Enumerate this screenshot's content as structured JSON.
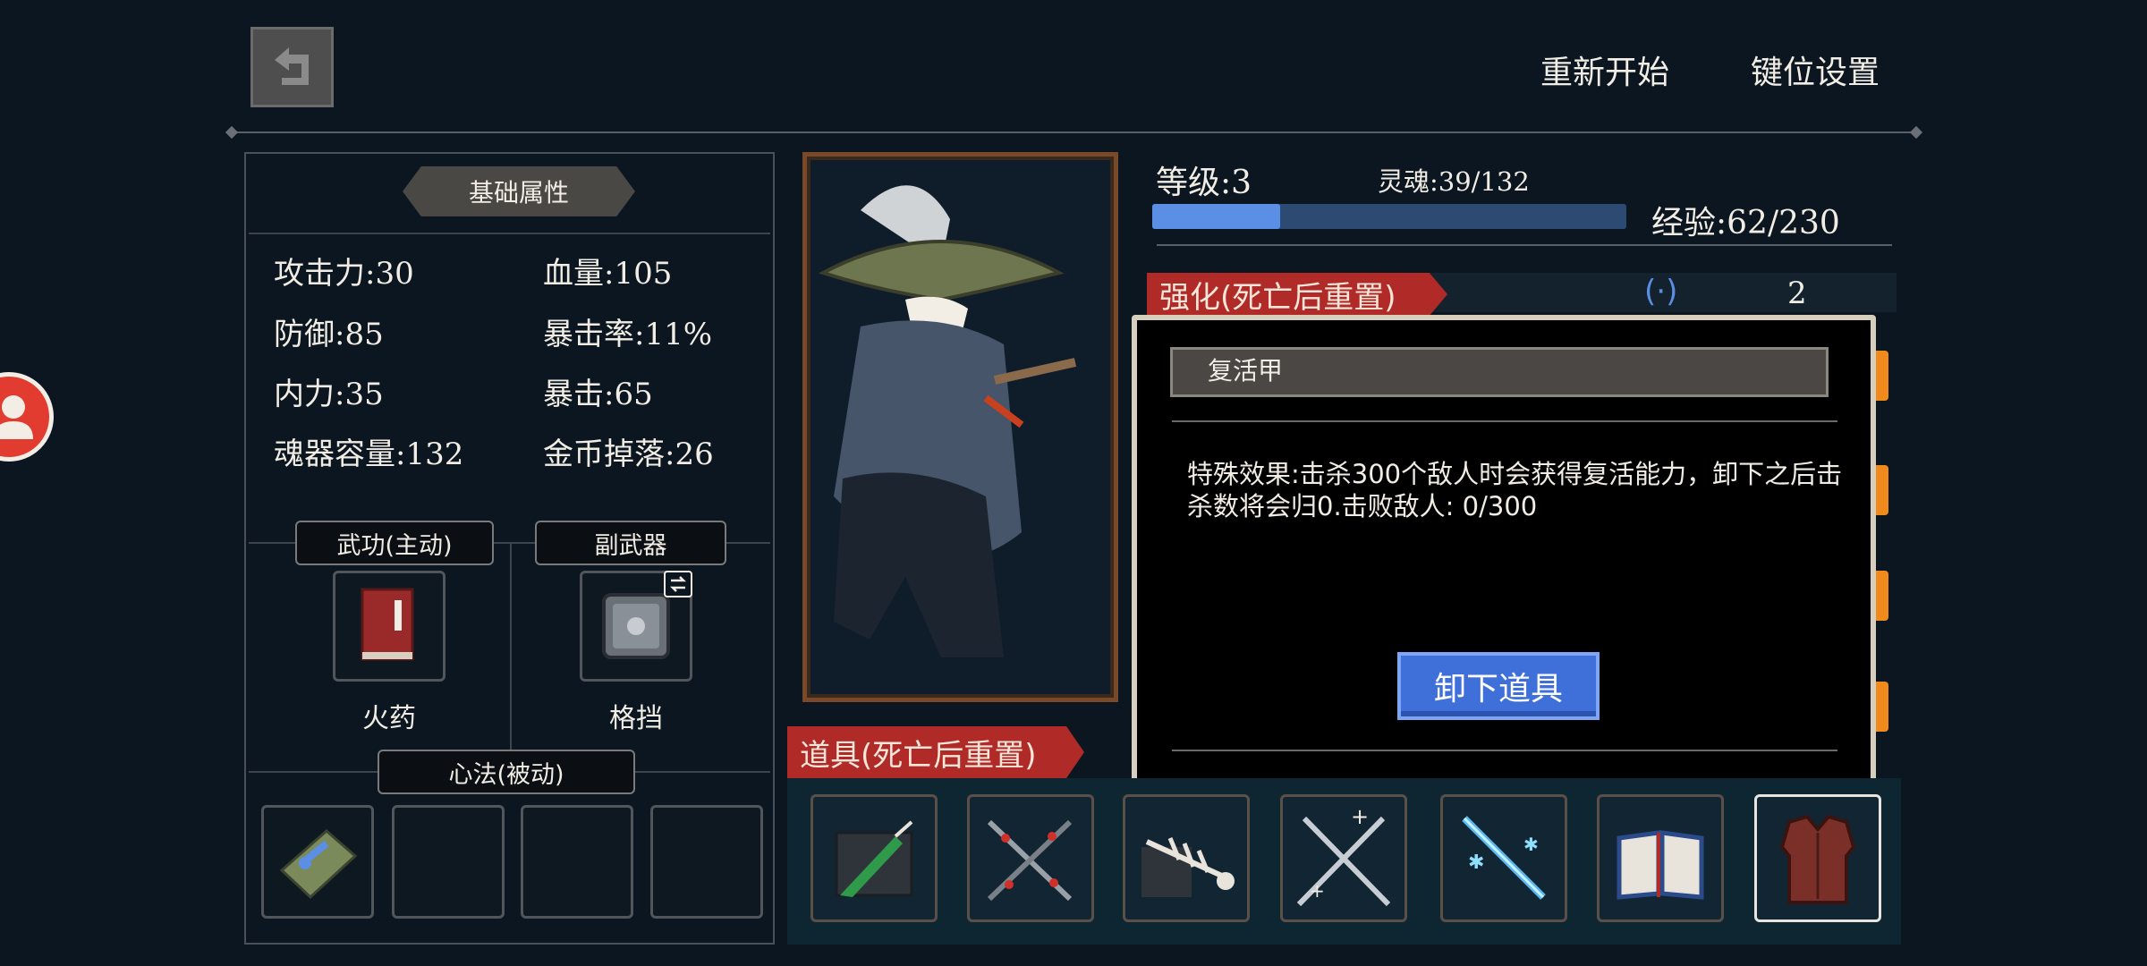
{
  "top_bar": {
    "restart_label": "重新开始",
    "keybind_label": "键位设置"
  },
  "attributes": {
    "header": "基础属性",
    "stats": [
      {
        "label": "攻击力:30"
      },
      {
        "label": "血量:105"
      },
      {
        "label": "防御:85"
      },
      {
        "label": "暴击率:11%"
      },
      {
        "label": "内力:35"
      },
      {
        "label": "暴击:65"
      },
      {
        "label": "魂器容量:132"
      },
      {
        "label": "金币掉落:26"
      }
    ]
  },
  "slots": {
    "martial_label": "武功(主动)",
    "martial_item": "火药",
    "secondary_label": "副武器",
    "secondary_item": "格挡",
    "passive_label": "心法(被动)"
  },
  "player": {
    "level": "等级:3",
    "soul": "灵魂:39/132",
    "xp": "经验:62/230",
    "xp_fraction": 0.27
  },
  "enhance": {
    "tab_label": "强化(死亡后重置)",
    "count": "2"
  },
  "tooltip": {
    "title": "复活甲",
    "description": "特殊效果:击杀300个敌人时会获得复活能力，卸下之后击杀数将会归0.击败敌人: 0/300",
    "unequip_label": "卸下道具"
  },
  "items": {
    "tab_label": "道具(死亡后重置)",
    "list": [
      {
        "icon": "feather-book-icon"
      },
      {
        "icon": "crossed-swords-red-icon"
      },
      {
        "icon": "fish-bone-icon"
      },
      {
        "icon": "crossed-swords-sparkle-icon"
      },
      {
        "icon": "ice-sword-icon"
      },
      {
        "icon": "open-book-icon"
      },
      {
        "icon": "armor-vest-icon"
      }
    ],
    "selected_index": 6
  },
  "colors": {
    "accent_red": "#b02a28",
    "xp_blue": "#5b8fe6",
    "button_blue": "#3f6fd9",
    "orange_tab": "#f08a1c"
  }
}
